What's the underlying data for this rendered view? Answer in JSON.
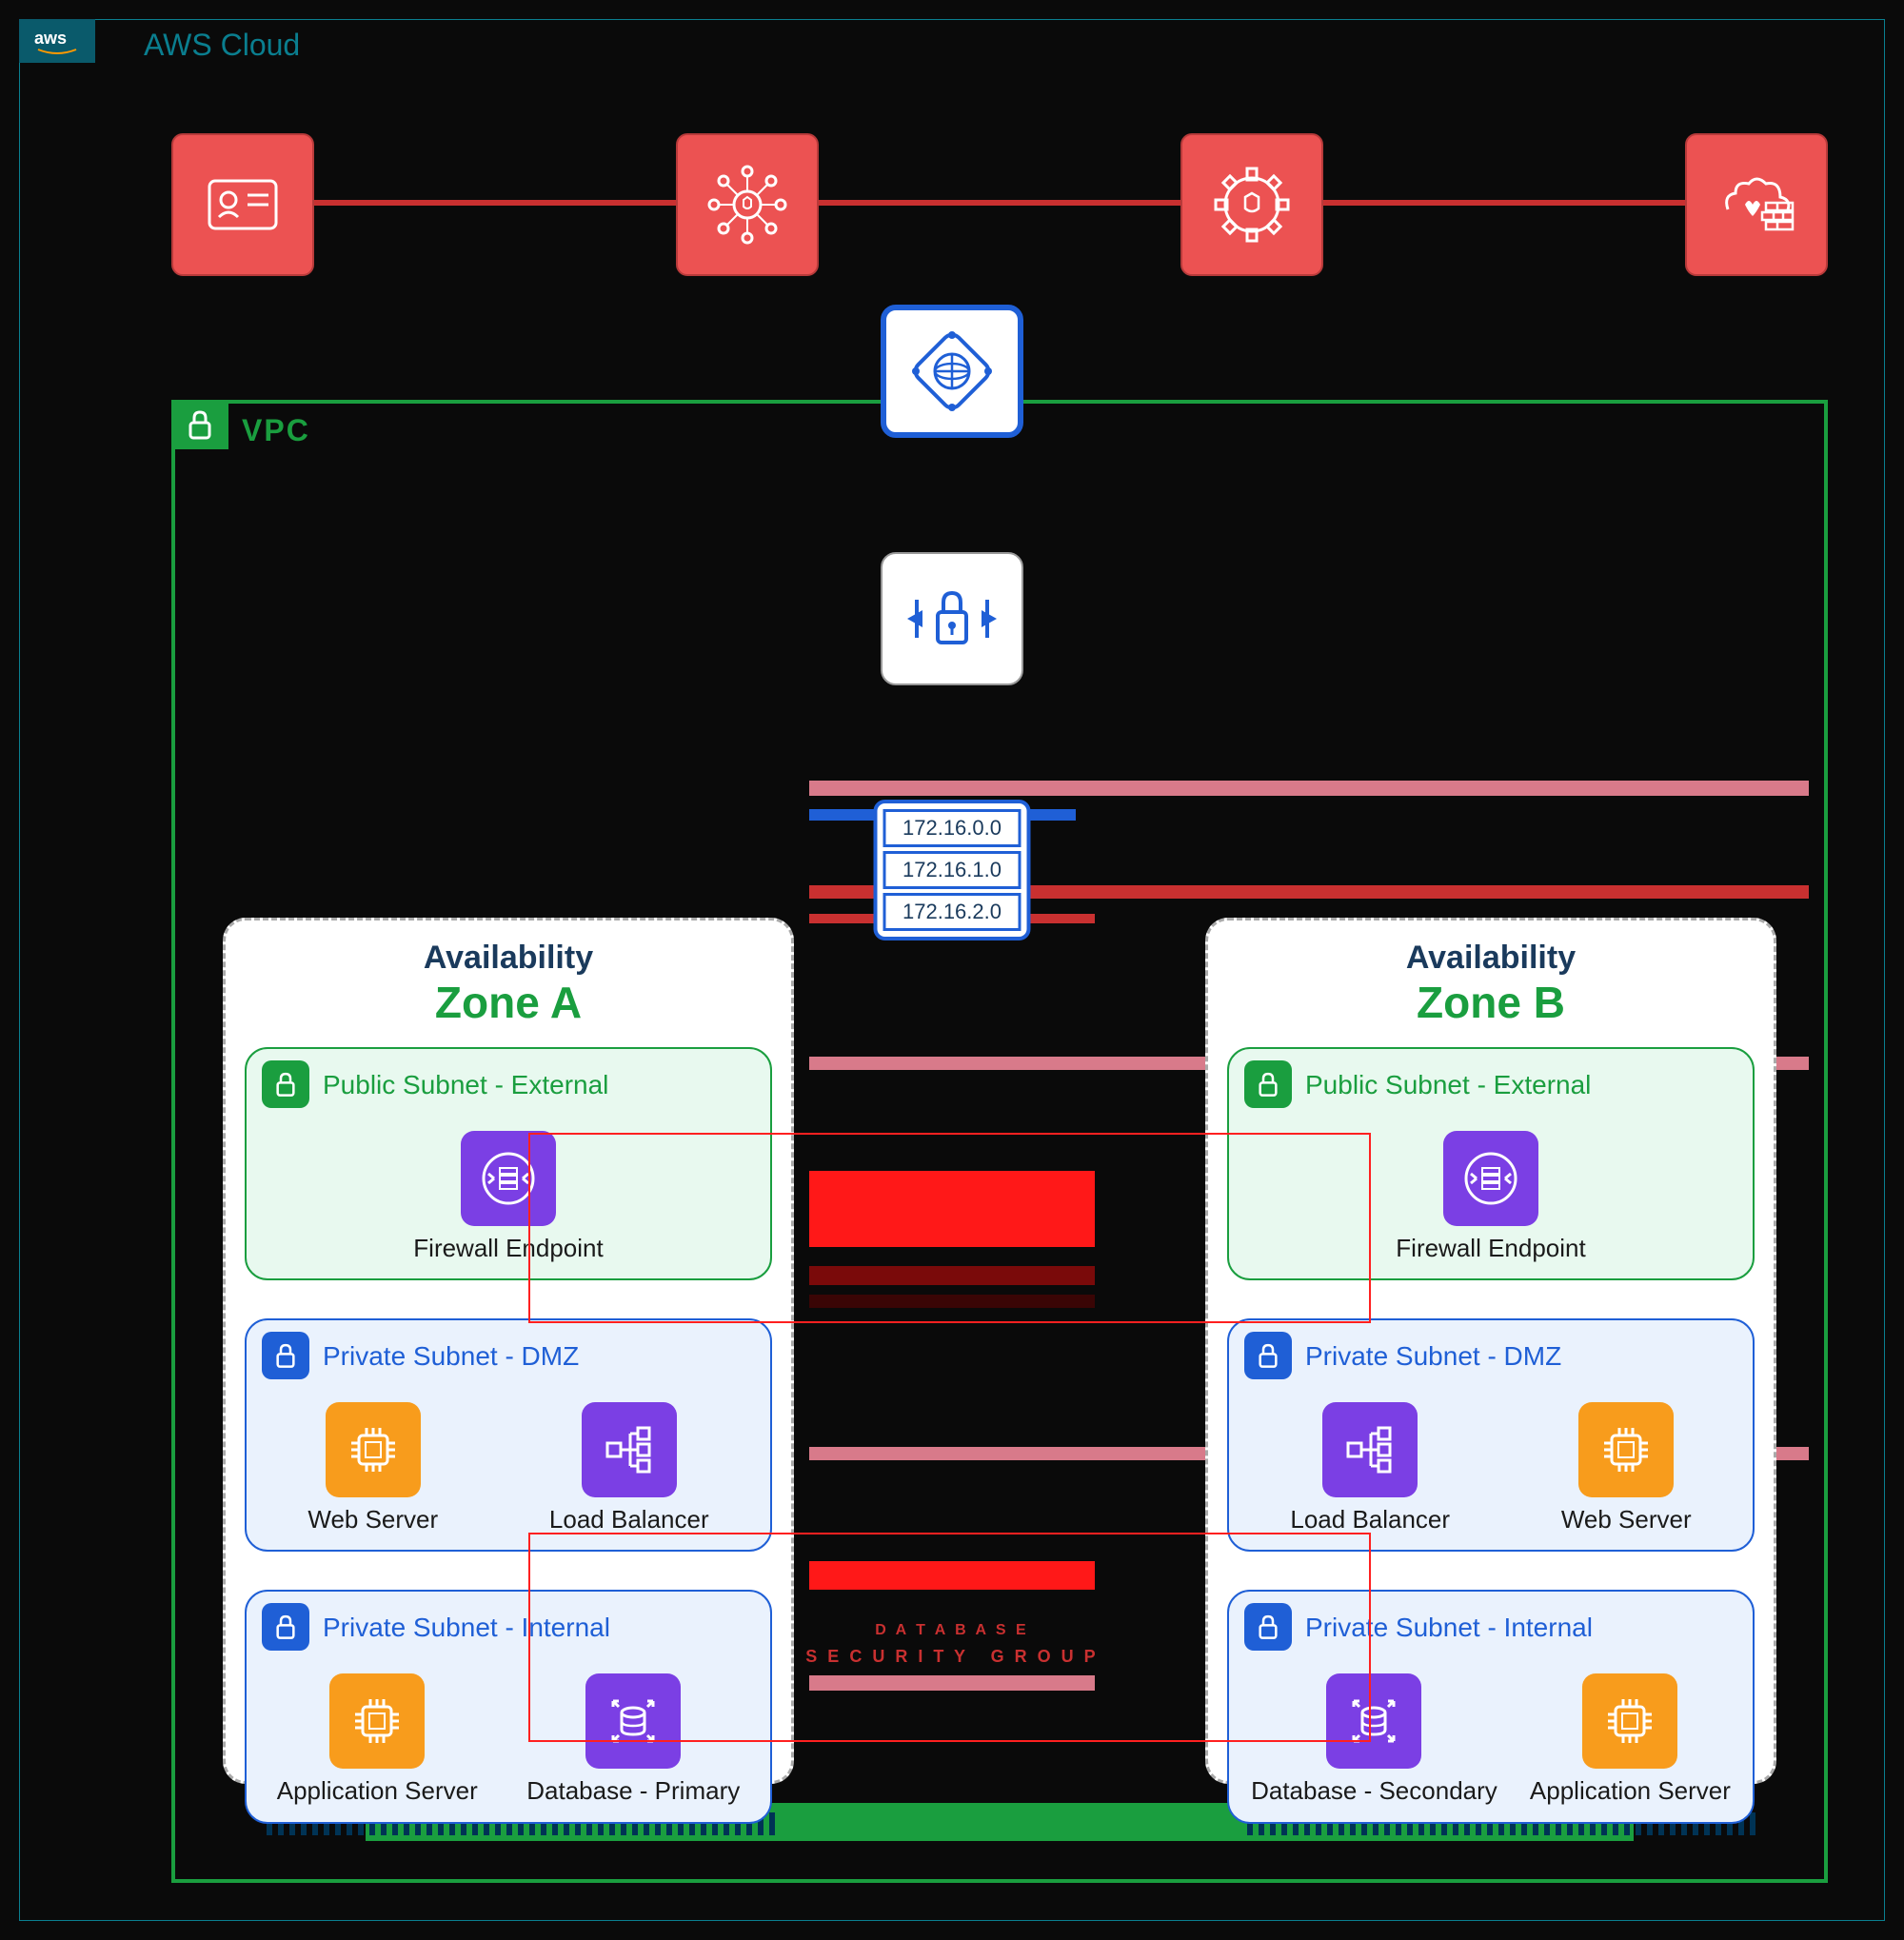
{
  "cloud": {
    "title": "AWS Cloud",
    "logo": "aws"
  },
  "security_services": {
    "iam": "IAM",
    "shield": "Security Hub",
    "config": "Config",
    "waf": "WAF"
  },
  "vpc": {
    "label": "VPC"
  },
  "gateway": {
    "type": "Internet Gateway"
  },
  "nacl": {
    "type": "Network ACL"
  },
  "cidrs": [
    "172.16.0.0",
    "172.16.1.0",
    "172.16.2.0"
  ],
  "availability_label": "Availability",
  "zones": {
    "a": {
      "name": "Zone A",
      "subnets": {
        "public": {
          "title": "Public Subnet - External",
          "resources": [
            {
              "label": "Firewall Endpoint",
              "icon": "firewall",
              "color": "purple"
            }
          ]
        },
        "dmz": {
          "title": "Private Subnet - DMZ",
          "resources": [
            {
              "label": "Web Server",
              "icon": "compute",
              "color": "orange"
            },
            {
              "label": "Load Balancer",
              "icon": "lb",
              "color": "purple"
            }
          ]
        },
        "internal": {
          "title": "Private Subnet - Internal",
          "resources": [
            {
              "label": "Application Server",
              "icon": "compute",
              "color": "orange"
            },
            {
              "label": "Database - Primary",
              "icon": "db",
              "color": "purple"
            }
          ]
        }
      }
    },
    "b": {
      "name": "Zone B",
      "subnets": {
        "public": {
          "title": "Public Subnet - External",
          "resources": [
            {
              "label": "Firewall Endpoint",
              "icon": "firewall",
              "color": "purple"
            }
          ]
        },
        "dmz": {
          "title": "Private Subnet - DMZ",
          "resources": [
            {
              "label": "Load Balancer",
              "icon": "lb",
              "color": "purple"
            },
            {
              "label": "Web Server",
              "icon": "compute",
              "color": "orange"
            }
          ]
        },
        "internal": {
          "title": "Private Subnet - Internal",
          "resources": [
            {
              "label": "Database - Secondary",
              "icon": "db",
              "color": "purple"
            },
            {
              "label": "Application Server",
              "icon": "compute",
              "color": "orange"
            }
          ]
        }
      }
    }
  },
  "security_groups": {
    "db_label": "DATABASE SECURITY GROUP"
  }
}
